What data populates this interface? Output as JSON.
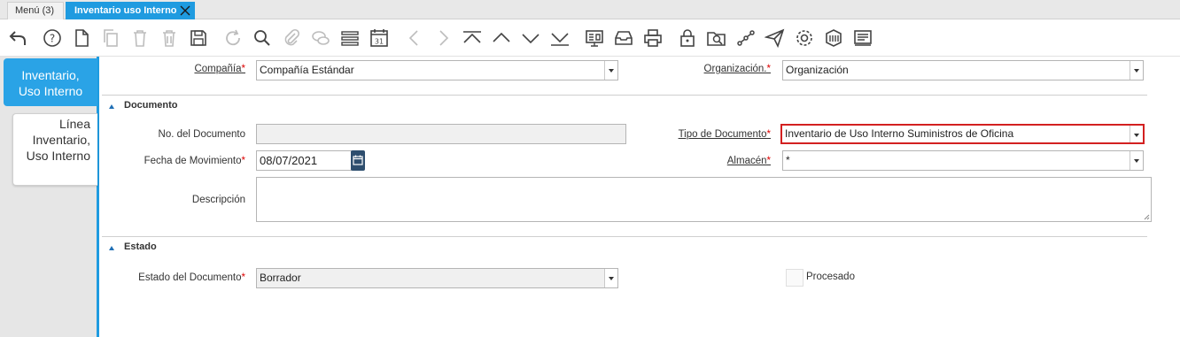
{
  "tabs": [
    {
      "label": "Menú (3)"
    },
    {
      "label": "Inventario uso Interno"
    }
  ],
  "toolbar": {
    "icons": [
      "undo-icon",
      "help-icon",
      "new-record-icon",
      "copy-icon",
      "delete-icon",
      "delete-selection-icon",
      "save-icon",
      "refresh-icon",
      "find-icon",
      "attachment-icon",
      "chat-icon",
      "grid-toggle-icon",
      "calendar-icon",
      "previous-icon",
      "next-icon",
      "first-record-icon",
      "parent-record-icon",
      "detail-record-icon",
      "last-record-icon",
      "report-icon",
      "archive-icon",
      "print-icon",
      "lock-icon",
      "zoom-across-icon",
      "workflow-icon",
      "send-icon",
      "process-icon",
      "product-info-icon",
      "request-icon"
    ]
  },
  "left_tabs": {
    "active": "Inventario, Uso Interno",
    "inactive": "Línea Inventario, Uso Interno"
  },
  "form": {
    "compania": {
      "label": "Compañía",
      "value": "Compañía Estándar"
    },
    "organizacion": {
      "label": "Organización.",
      "value": "Organización"
    },
    "documento_section": "Documento",
    "no_documento": {
      "label": "No. del Documento",
      "value": ""
    },
    "tipo_documento": {
      "label": "Tipo de Documento",
      "value": "Inventario de Uso Interno Suministros de Oficina"
    },
    "fecha_movimiento": {
      "label": "Fecha de Movimiento",
      "value": "08/07/2021"
    },
    "almacen": {
      "label": "Almacén",
      "value": "*"
    },
    "descripcion": {
      "label": "Descripción",
      "value": ""
    },
    "estado_section": "Estado",
    "estado_documento": {
      "label": "Estado del Documento",
      "value": "Borrador"
    },
    "procesado": {
      "label": "Procesado",
      "checked": false
    }
  },
  "colors": {
    "accent": "#1f9be0",
    "required": "#dd0000",
    "highlight": "#d32020"
  }
}
